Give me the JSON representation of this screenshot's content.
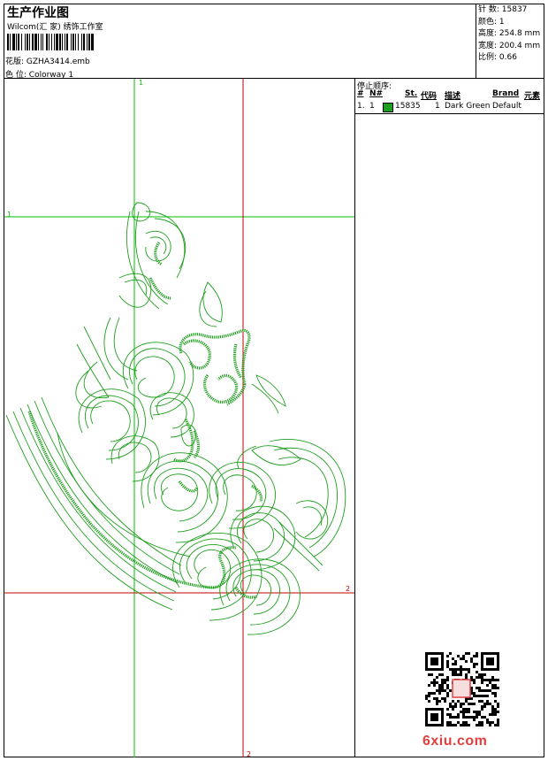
{
  "header": {
    "title": "生产作业图",
    "subtitle": "Wilcom(汇 家) 绣饰工作室",
    "file_label": "花版:",
    "file_value": "GZHA3414.emb",
    "color_label": "色 位:",
    "color_value": "Colorway 1"
  },
  "stats": {
    "stitches_label": "针 数:",
    "stitches_value": "15837",
    "colors_label": "颜色:",
    "colors_value": "1",
    "height_label": "高度:",
    "height_value": "254.8 mm",
    "width_label": "宽度:",
    "width_value": "200.4 mm",
    "ratio_label": "比例:",
    "ratio_value": "0.66"
  },
  "stop_sequence": {
    "title": "停止顺序:",
    "columns": {
      "num": "#",
      "n": "N#",
      "st": "St.",
      "code": "代码",
      "desc": "描述",
      "brand": "Brand",
      "element": "元素"
    },
    "rows": [
      {
        "num": "1.",
        "n": "1",
        "color": "#1e9e1e",
        "st": "15835",
        "code": "1",
        "desc": "Dark Green",
        "brand": "Default"
      }
    ]
  },
  "guides": {
    "v1_label": "1",
    "h1_label": "1",
    "v2_label": "2",
    "h2_label": "2"
  },
  "colors": {
    "design_green": "#1e9e1e",
    "guide_green": "#00c000",
    "guide_red": "#c00000",
    "site_red": "#e24040"
  },
  "watermark": {
    "site_text": "6xiu.com"
  }
}
